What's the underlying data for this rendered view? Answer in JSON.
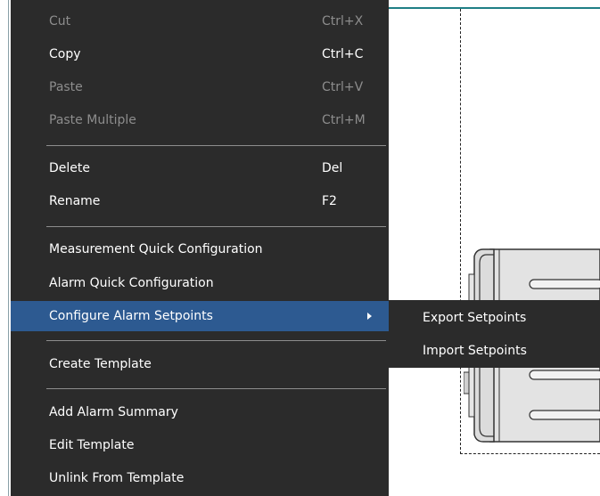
{
  "context_menu": {
    "items": [
      {
        "label": "Cut",
        "shortcut": "Ctrl+X",
        "disabled": true
      },
      {
        "label": "Copy",
        "shortcut": "Ctrl+C"
      },
      {
        "label": "Paste",
        "shortcut": "Ctrl+V",
        "disabled": true
      },
      {
        "label": "Paste Multiple",
        "shortcut": "Ctrl+M",
        "disabled": true
      },
      {
        "label": "Delete",
        "shortcut": "Del"
      },
      {
        "label": "Rename",
        "shortcut": "F2"
      },
      {
        "label": "Measurement Quick Configuration"
      },
      {
        "label": "Alarm Quick Configuration"
      },
      {
        "label": "Configure Alarm Setpoints",
        "has_submenu": true,
        "highlighted": true
      },
      {
        "label": "Create Template"
      },
      {
        "label": "Add Alarm Summary"
      },
      {
        "label": "Edit Template"
      },
      {
        "label": "Unlink From Template"
      }
    ]
  },
  "submenu": {
    "items": [
      {
        "label": "Export Setpoints"
      },
      {
        "label": "Import Setpoints"
      }
    ]
  },
  "colors": {
    "menu_background": "#2b2b2b",
    "highlight": "#2d5a91",
    "disabled_text": "#8d8d8d",
    "accent_border": "#1f7f86"
  },
  "icons": {
    "submenu_arrow": "chevron-right-icon"
  }
}
